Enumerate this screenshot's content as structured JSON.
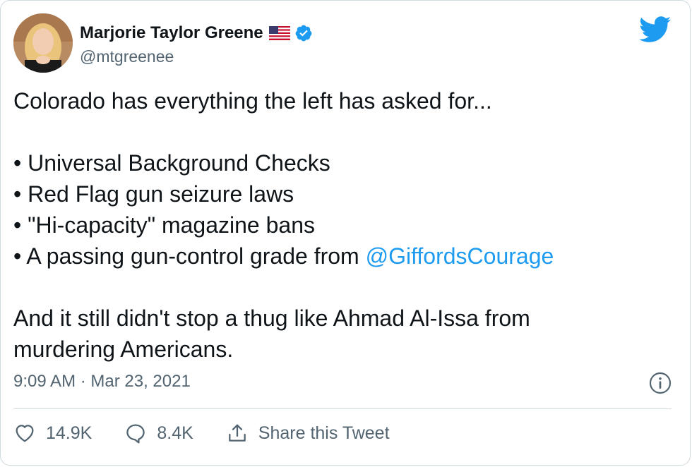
{
  "tweet": {
    "author_name": "Marjorie Taylor Greene",
    "author_handle": "@mtgreenee",
    "intro": "Colorado has everything the left has asked for...",
    "bullets": [
      "• Universal Background Checks",
      "• Red Flag gun seizure laws",
      "• \"Hi-capacity\" magazine bans",
      "• A passing gun-control grade from "
    ],
    "mention": "@GiffordsCourage",
    "closing": "And it still didn't stop a thug like Ahmad Al-Issa from\nmurdering Americans.",
    "timestamp": "9:09 AM · Mar 23, 2021"
  },
  "actions": {
    "likes": "14.9K",
    "replies": "8.4K",
    "share_label": "Share this Tweet"
  },
  "colors": {
    "link": "#1d9bf0",
    "verified": "#1d9bf0",
    "secondary_text": "#536471"
  },
  "icons": [
    "verified-badge-icon",
    "us-flag-icon",
    "twitter-bird-icon",
    "info-icon",
    "heart-icon",
    "reply-bubble-icon",
    "share-icon"
  ]
}
